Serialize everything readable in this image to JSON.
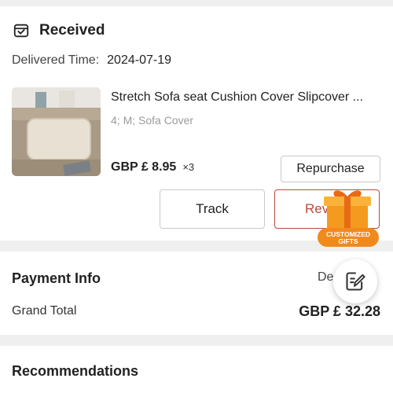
{
  "order": {
    "status": "Received",
    "status_icon": "package-box-icon",
    "delivered_label": "Delivered Time:",
    "delivered_value": "2024-07-19",
    "product": {
      "title": "Stretch Sofa seat Cushion Cover Slipcover ...",
      "variant": "4; M; Sofa Cover",
      "price": "GBP £ 8.95",
      "quantity": "×3"
    },
    "buttons": {
      "repurchase": "Repurchase",
      "track": "Track",
      "review": "Rev"
    },
    "gift_badge": {
      "line1": "CUSTOMIZED",
      "line2": "GIFTS",
      "accent": "#f08a1c"
    }
  },
  "payment": {
    "title": "Payment Info",
    "detail_link": "De",
    "grand_total_label": "Grand Total",
    "grand_total_value": "GBP £ 32.28"
  },
  "recommendations": {
    "title": "Recommendations"
  },
  "colors": {
    "background": "#efefef",
    "card": "#ffffff",
    "review_accent": "#b94a3b"
  }
}
